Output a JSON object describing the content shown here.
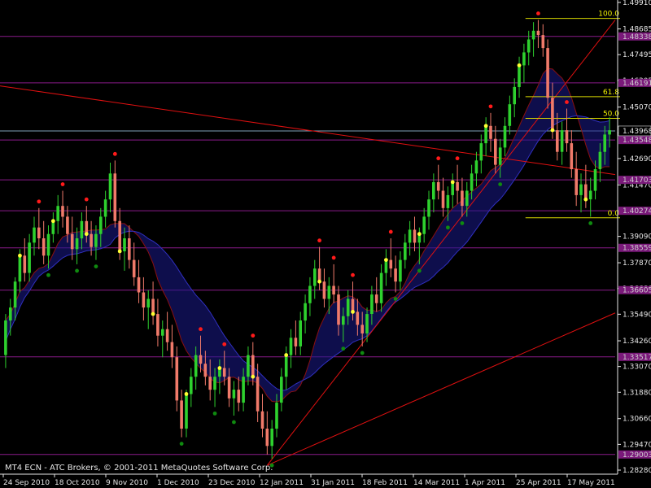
{
  "window": {
    "watermark": "MT4 ECN - ATC Brokers, © 2001-2011 MetaQuotes Software Corp."
  },
  "colors": {
    "background": "#000000",
    "bull": "#2ed12e",
    "bear": "#f07a6a",
    "level": "#8a1a8a",
    "levelBox": "#7a197a",
    "trend": "#e01010",
    "cloud": "#1a1a8a",
    "fib": "#d8d800",
    "axis": "#e6e6e6",
    "current": "#7fa0b8",
    "dotRed": "#ff1a1a",
    "dotYellow": "#ffff33",
    "dotGreen": "#0f8a0f"
  },
  "chart_data": {
    "type": "candlestick",
    "title": "",
    "xlabel": "",
    "ylabel": "",
    "ylim": [
      1.2828,
      1.4991
    ],
    "current_price": "1.43968",
    "y_ticks": [
      "1.49910",
      "1.48685",
      "1.47495",
      "1.46305",
      "1.45070",
      "1.43880",
      "1.42690",
      "1.41470",
      "1.40280",
      "1.39090",
      "1.37870",
      "1.36680",
      "1.35490",
      "1.34260",
      "1.33070",
      "1.31880",
      "1.30660",
      "1.29470",
      "1.28280"
    ],
    "x_ticks": [
      "24 Sep 2010",
      "18 Oct 2010",
      "9 Nov 2010",
      "1 Dec 2010",
      "23 Dec 2010",
      "12 Jan 2011",
      "31 Jan 2011",
      "18 Feb 2011",
      "14 Mar 2011",
      "1 Apr 2011",
      "25 Apr 2011",
      "17 May 2011"
    ],
    "levels": [
      {
        "label": "1.48338",
        "value": 1.48338
      },
      {
        "label": "1.46191",
        "value": 1.46191
      },
      {
        "label": "1.43548",
        "value": 1.43548
      },
      {
        "label": "1.41703",
        "value": 1.41703
      },
      {
        "label": "1.40274",
        "value": 1.40274
      },
      {
        "label": "1.38559",
        "value": 1.38559
      },
      {
        "label": "1.36605",
        "value": 1.36605
      },
      {
        "label": "1.33517",
        "value": 1.33517
      },
      {
        "label": "1.29003",
        "value": 1.29003
      }
    ],
    "fibonacci": [
      {
        "label": "100.0",
        "value": 1.4917
      },
      {
        "label": "61.8",
        "value": 1.4555
      },
      {
        "label": "50.0",
        "value": 1.4455
      },
      {
        "label": "0.0",
        "value": 1.3995
      }
    ],
    "series": [
      {
        "name": "",
        "ohlc": [
          [
            1.336,
            1.355,
            1.33,
            1.352
          ],
          [
            1.352,
            1.362,
            1.345,
            1.358
          ],
          [
            1.358,
            1.372,
            1.352,
            1.37
          ],
          [
            1.37,
            1.385,
            1.365,
            1.382
          ],
          [
            1.382,
            1.39,
            1.37,
            1.374
          ],
          [
            1.374,
            1.392,
            1.37,
            1.388
          ],
          [
            1.388,
            1.4,
            1.382,
            1.395
          ],
          [
            1.395,
            1.404,
            1.385,
            1.39
          ],
          [
            1.39,
            1.398,
            1.378,
            1.382
          ],
          [
            1.382,
            1.396,
            1.376,
            1.392
          ],
          [
            1.392,
            1.402,
            1.388,
            1.398
          ],
          [
            1.398,
            1.41,
            1.392,
            1.405
          ],
          [
            1.405,
            1.412,
            1.395,
            1.4
          ],
          [
            1.4,
            1.405,
            1.388,
            1.392
          ],
          [
            1.392,
            1.4,
            1.38,
            1.385
          ],
          [
            1.385,
            1.395,
            1.378,
            1.39
          ],
          [
            1.39,
            1.402,
            1.385,
            1.398
          ],
          [
            1.398,
            1.405,
            1.388,
            1.392
          ],
          [
            1.392,
            1.398,
            1.382,
            1.386
          ],
          [
            1.386,
            1.396,
            1.38,
            1.392
          ],
          [
            1.392,
            1.404,
            1.386,
            1.4
          ],
          [
            1.4,
            1.412,
            1.395,
            1.408
          ],
          [
            1.408,
            1.425,
            1.402,
            1.42
          ],
          [
            1.42,
            1.426,
            1.395,
            1.398
          ],
          [
            1.398,
            1.404,
            1.38,
            1.384
          ],
          [
            1.384,
            1.395,
            1.375,
            1.39
          ],
          [
            1.39,
            1.396,
            1.376,
            1.38
          ],
          [
            1.38,
            1.388,
            1.368,
            1.372
          ],
          [
            1.372,
            1.38,
            1.36,
            1.365
          ],
          [
            1.365,
            1.372,
            1.352,
            1.358
          ],
          [
            1.358,
            1.366,
            1.348,
            1.362
          ],
          [
            1.362,
            1.37,
            1.35,
            1.355
          ],
          [
            1.355,
            1.362,
            1.34,
            1.345
          ],
          [
            1.345,
            1.352,
            1.335,
            1.348
          ],
          [
            1.348,
            1.356,
            1.338,
            1.342
          ],
          [
            1.342,
            1.35,
            1.33,
            1.335
          ],
          [
            1.335,
            1.34,
            1.31,
            1.315
          ],
          [
            1.315,
            1.32,
            1.298,
            1.302
          ],
          [
            1.302,
            1.32,
            1.298,
            1.318
          ],
          [
            1.318,
            1.33,
            1.312,
            1.326
          ],
          [
            1.326,
            1.34,
            1.32,
            1.336
          ],
          [
            1.336,
            1.345,
            1.328,
            1.332
          ],
          [
            1.332,
            1.338,
            1.322,
            1.326
          ],
          [
            1.326,
            1.334,
            1.315,
            1.32
          ],
          [
            1.32,
            1.33,
            1.312,
            1.326
          ],
          [
            1.326,
            1.334,
            1.318,
            1.33
          ],
          [
            1.33,
            1.338,
            1.322,
            1.326
          ],
          [
            1.326,
            1.33,
            1.312,
            1.316
          ],
          [
            1.316,
            1.324,
            1.308,
            1.32
          ],
          [
            1.32,
            1.326,
            1.31,
            1.314
          ],
          [
            1.314,
            1.33,
            1.31,
            1.326
          ],
          [
            1.326,
            1.34,
            1.322,
            1.336
          ],
          [
            1.336,
            1.342,
            1.322,
            1.326
          ],
          [
            1.326,
            1.332,
            1.305,
            1.31
          ],
          [
            1.31,
            1.318,
            1.298,
            1.302
          ],
          [
            1.302,
            1.31,
            1.29,
            1.294
          ],
          [
            1.294,
            1.306,
            1.288,
            1.302
          ],
          [
            1.302,
            1.318,
            1.298,
            1.314
          ],
          [
            1.314,
            1.33,
            1.31,
            1.326
          ],
          [
            1.326,
            1.34,
            1.32,
            1.336
          ],
          [
            1.336,
            1.348,
            1.33,
            1.344
          ],
          [
            1.344,
            1.352,
            1.336,
            1.34
          ],
          [
            1.34,
            1.356,
            1.336,
            1.352
          ],
          [
            1.352,
            1.364,
            1.346,
            1.36
          ],
          [
            1.36,
            1.372,
            1.354,
            1.368
          ],
          [
            1.368,
            1.38,
            1.362,
            1.376
          ],
          [
            1.376,
            1.386,
            1.366,
            1.37
          ],
          [
            1.37,
            1.376,
            1.358,
            1.362
          ],
          [
            1.362,
            1.372,
            1.355,
            1.368
          ],
          [
            1.368,
            1.378,
            1.36,
            1.364
          ],
          [
            1.364,
            1.368,
            1.345,
            1.35
          ],
          [
            1.35,
            1.358,
            1.342,
            1.354
          ],
          [
            1.354,
            1.366,
            1.35,
            1.362
          ],
          [
            1.362,
            1.37,
            1.352,
            1.356
          ],
          [
            1.356,
            1.362,
            1.345,
            1.35
          ],
          [
            1.35,
            1.356,
            1.34,
            1.346
          ],
          [
            1.346,
            1.358,
            1.342,
            1.355
          ],
          [
            1.355,
            1.368,
            1.35,
            1.364
          ],
          [
            1.364,
            1.372,
            1.356,
            1.36
          ],
          [
            1.36,
            1.378,
            1.356,
            1.374
          ],
          [
            1.374,
            1.385,
            1.368,
            1.38
          ],
          [
            1.38,
            1.39,
            1.372,
            1.376
          ],
          [
            1.376,
            1.382,
            1.365,
            1.37
          ],
          [
            1.37,
            1.384,
            1.366,
            1.38
          ],
          [
            1.38,
            1.392,
            1.376,
            1.388
          ],
          [
            1.388,
            1.398,
            1.382,
            1.394
          ],
          [
            1.394,
            1.4,
            1.384,
            1.388
          ],
          [
            1.388,
            1.395,
            1.378,
            1.392
          ],
          [
            1.392,
            1.404,
            1.388,
            1.4
          ],
          [
            1.4,
            1.412,
            1.394,
            1.408
          ],
          [
            1.408,
            1.42,
            1.402,
            1.416
          ],
          [
            1.416,
            1.424,
            1.408,
            1.412
          ],
          [
            1.412,
            1.418,
            1.4,
            1.404
          ],
          [
            1.404,
            1.414,
            1.398,
            1.41
          ],
          [
            1.41,
            1.42,
            1.404,
            1.416
          ],
          [
            1.416,
            1.424,
            1.406,
            1.412
          ],
          [
            1.412,
            1.418,
            1.4,
            1.405
          ],
          [
            1.405,
            1.416,
            1.4,
            1.412
          ],
          [
            1.412,
            1.424,
            1.408,
            1.42
          ],
          [
            1.42,
            1.43,
            1.414,
            1.426
          ],
          [
            1.426,
            1.438,
            1.42,
            1.434
          ],
          [
            1.434,
            1.446,
            1.428,
            1.442
          ],
          [
            1.442,
            1.448,
            1.43,
            1.436
          ],
          [
            1.436,
            1.442,
            1.42,
            1.424
          ],
          [
            1.424,
            1.436,
            1.418,
            1.432
          ],
          [
            1.432,
            1.446,
            1.428,
            1.442
          ],
          [
            1.442,
            1.456,
            1.438,
            1.452
          ],
          [
            1.452,
            1.464,
            1.446,
            1.46
          ],
          [
            1.46,
            1.474,
            1.455,
            1.47
          ],
          [
            1.47,
            1.48,
            1.462,
            1.476
          ],
          [
            1.476,
            1.486,
            1.47,
            1.482
          ],
          [
            1.482,
            1.49,
            1.474,
            1.486
          ],
          [
            1.486,
            1.491,
            1.478,
            1.484
          ],
          [
            1.484,
            1.489,
            1.474,
            1.478
          ],
          [
            1.478,
            1.482,
            1.45,
            1.455
          ],
          [
            1.455,
            1.462,
            1.436,
            1.44
          ],
          [
            1.44,
            1.448,
            1.426,
            1.43
          ],
          [
            1.43,
            1.444,
            1.424,
            1.44
          ],
          [
            1.44,
            1.45,
            1.43,
            1.434
          ],
          [
            1.434,
            1.44,
            1.418,
            1.422
          ],
          [
            1.422,
            1.43,
            1.405,
            1.41
          ],
          [
            1.41,
            1.42,
            1.402,
            1.415
          ],
          [
            1.415,
            1.424,
            1.404,
            1.408
          ],
          [
            1.408,
            1.418,
            1.4,
            1.412
          ],
          [
            1.412,
            1.426,
            1.408,
            1.422
          ],
          [
            1.422,
            1.434,
            1.416,
            1.43
          ],
          [
            1.43,
            1.442,
            1.424,
            1.438
          ],
          [
            1.438,
            1.446,
            1.432,
            1.44
          ]
        ]
      }
    ]
  }
}
